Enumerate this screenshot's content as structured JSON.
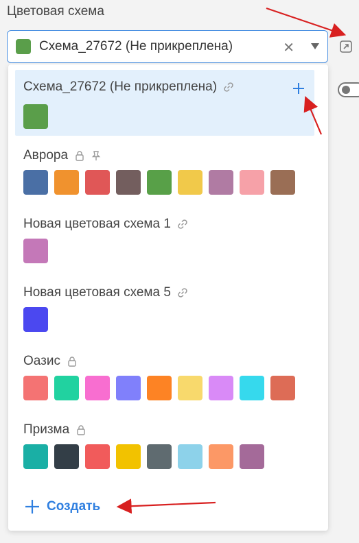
{
  "field_label": "Цветовая схема",
  "select": {
    "value": "Схема_27672 (Не прикреплена)",
    "swatch_color": "#5a9e4a"
  },
  "schemes": [
    {
      "name": "Схема_27672 (Не прикреплена)",
      "icons": [
        "link-icon"
      ],
      "selected": true,
      "colors": [
        "#5a9e4a"
      ]
    },
    {
      "name": "Аврора",
      "icons": [
        "lock-icon",
        "pin-icon"
      ],
      "colors": [
        "#4a6fa5",
        "#f0922e",
        "#e05757",
        "#735e5e",
        "#58a048",
        "#f1c94a",
        "#b07ba3",
        "#f6a1a8",
        "#9a6e55"
      ]
    },
    {
      "name": "Новая цветовая схема 1",
      "icons": [
        "link-icon"
      ],
      "colors": [
        "#c478b8"
      ]
    },
    {
      "name": "Новая цветовая схема 5",
      "icons": [
        "link-icon"
      ],
      "colors": [
        "#4b48f0"
      ]
    },
    {
      "name": "Оазис",
      "icons": [
        "lock-icon"
      ],
      "colors": [
        "#f47373",
        "#21d2a0",
        "#f86ed0",
        "#8080fb",
        "#fd8324",
        "#f8d96c",
        "#d98af7",
        "#36d9ed",
        "#dd6c56"
      ]
    },
    {
      "name": "Призма",
      "icons": [
        "lock-icon"
      ],
      "colors": [
        "#1aafa5",
        "#333e47",
        "#f15b5b",
        "#f2c200",
        "#5f6b70",
        "#8dd2ea",
        "#fc9866",
        "#a46a99"
      ]
    }
  ],
  "create_label": "Создать",
  "accent_color": "#2f7fe0",
  "annotation_color": "#d82020"
}
